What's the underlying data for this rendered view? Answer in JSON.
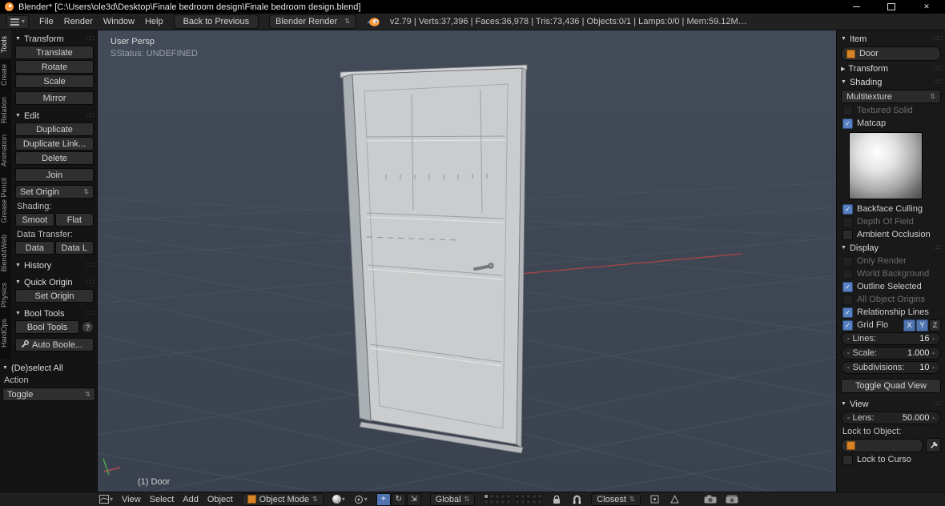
{
  "icons": {
    "collapse_open": "▼",
    "collapse_closed": "▶",
    "grip": "∷∷",
    "dropdown": "▾",
    "dropdown_updown": "⇅",
    "check": "✓",
    "help": "?",
    "close": "✕",
    "translate": "+",
    "rotate": "↻",
    "scale": "⇲",
    "arrow_left": "◂",
    "arrow_right": "▸"
  },
  "title_bar": {
    "app_title": "Blender* [C:\\Users\\ole3d\\Desktop\\Finale bedroom design\\Finale bedroom design.blend]"
  },
  "top_header": {
    "menus": [
      "File",
      "Render",
      "Window",
      "Help"
    ],
    "back_button": "Back to Previous",
    "engine": "Blender Render",
    "stats": "v2.79 | Verts:37,396 | Faces:36,978 | Tris:73,436 | Objects:0/1 | Lamps:0/0 | Mem:59.12M…"
  },
  "tool_tabs": [
    "Tools",
    "Create",
    "Relation",
    "Animation",
    "Grease Pencil",
    "Blend4Web",
    "Physics",
    "HardOps"
  ],
  "tool_shelf": {
    "transform": {
      "title": "Transform",
      "buttons": [
        "Translate",
        "Rotate",
        "Scale",
        "Mirror"
      ]
    },
    "edit": {
      "title": "Edit",
      "buttons": [
        "Duplicate",
        "Duplicate Link...",
        "Delete",
        "Join"
      ],
      "set_origin": "Set Origin",
      "shading_label": "Shading:",
      "smooth": "Smoot",
      "flat": "Flat",
      "data_label": "Data Transfer:",
      "data": "Data",
      "data_l": "Data L"
    },
    "history": {
      "title": "History"
    },
    "quick_origin": {
      "title": "Quick Origin",
      "set_origin": "Set Origin"
    },
    "bool_tools": {
      "title": "Bool Tools",
      "button": "Bool Tools",
      "auto_button": "Auto Boole..."
    },
    "deselect": {
      "title": "(De)select All",
      "action_label": "Action",
      "toggle": "Toggle"
    }
  },
  "viewport": {
    "view_label": "User Persp",
    "status_label": "SStatus: UNDEFINED",
    "object_label": "(1) Door"
  },
  "npanel": {
    "item": {
      "title": "Item",
      "name_value": "Door"
    },
    "transform": {
      "title": "Transform"
    },
    "shading": {
      "title": "Shading",
      "mode": "Multitexture",
      "textured_solid": {
        "label": "Textured Solid",
        "checked": false
      },
      "matcap": {
        "label": "Matcap",
        "checked": true
      },
      "backface": {
        "label": "Backface Culling",
        "checked": true
      },
      "dof": {
        "label": "Depth Of Field",
        "checked": false
      },
      "ao": {
        "label": "Ambient Occlusion",
        "checked": false
      }
    },
    "display": {
      "title": "Display",
      "only_render": {
        "label": "Only Render",
        "checked": false
      },
      "world_bg": {
        "label": "World Background",
        "checked": false
      },
      "outline": {
        "label": "Outline Selected",
        "checked": true
      },
      "origins": {
        "label": "All Object Origins",
        "checked": false
      },
      "relationship": {
        "label": "Relationship Lines",
        "checked": true
      },
      "grid_floor": {
        "label": "Grid Flo",
        "checked": true,
        "axes": [
          "X",
          "Y",
          "Z"
        ]
      },
      "lines": {
        "label": "Lines:",
        "value": "16"
      },
      "scale": {
        "label": "Scale:",
        "value": "1.000"
      },
      "subdivisions": {
        "label": "Subdivisions:",
        "value": "10"
      },
      "quad_view": "Toggle Quad View"
    },
    "view": {
      "title": "View",
      "lens": {
        "label": "Lens:",
        "value": "50.000"
      },
      "lock_object_label": "Lock to Object:",
      "lock_cursor_label": "Lock to Curso"
    }
  },
  "bottom_bar": {
    "menus": [
      "View",
      "Select",
      "Add",
      "Object"
    ],
    "mode": "Object Mode",
    "orientation": "Global",
    "snap_mode": "Closest"
  },
  "colors": {
    "accent_orange": "#d78428",
    "accent_blue": "#4f74b0",
    "viewport_bg": "#3d4553",
    "axis_red": "#a64545"
  }
}
